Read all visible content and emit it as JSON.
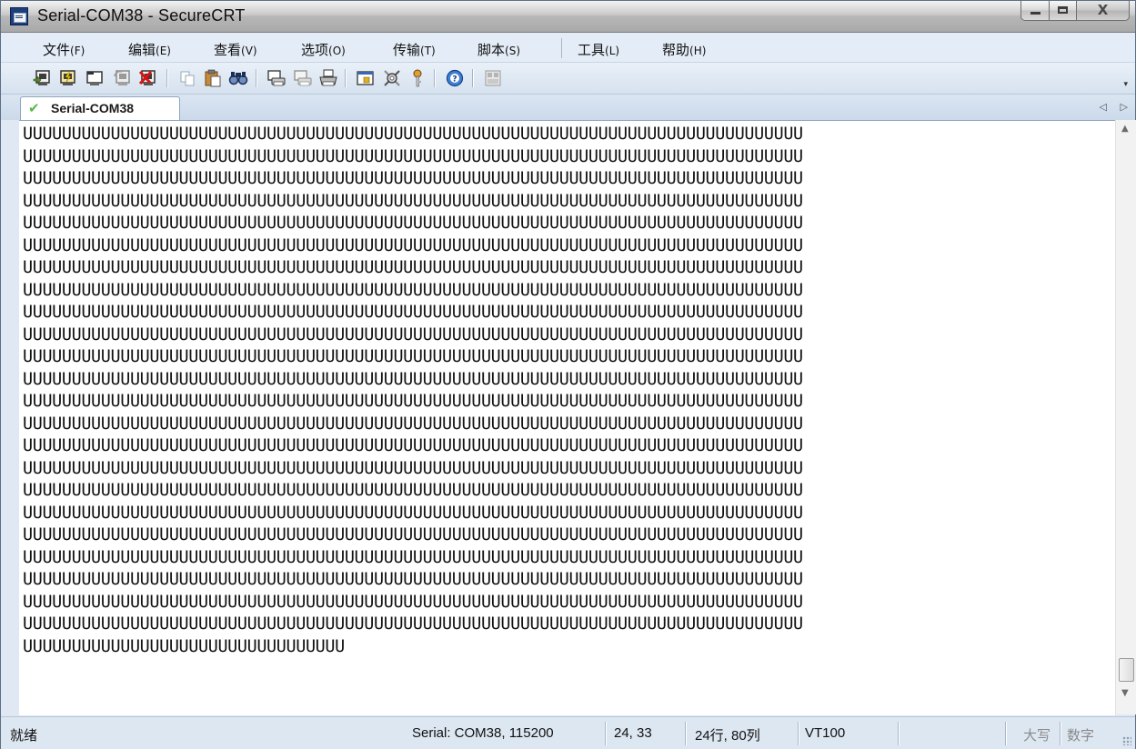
{
  "window": {
    "title": "Serial-COM38 - SecureCRT",
    "close_label": "X"
  },
  "menu": {
    "items": [
      {
        "label": "文件",
        "key": "(F)"
      },
      {
        "label": "编辑",
        "key": "(E)"
      },
      {
        "label": "查看",
        "key": "(V)"
      },
      {
        "label": "选项",
        "key": "(O)"
      },
      {
        "label": "传输",
        "key": "(T)"
      },
      {
        "label": "脚本",
        "key": "(S)"
      },
      {
        "label": "工具",
        "key": "(L)"
      },
      {
        "label": "帮助",
        "key": "(H)"
      }
    ]
  },
  "toolbar": {
    "icons": [
      "connect-icon",
      "quick-connect-icon",
      "connect-in-tab-icon",
      "reconnect-icon",
      "disconnect-icon",
      "copy-icon",
      "paste-icon",
      "find-icon",
      "print-screen-icon",
      "print-selection-icon",
      "print-icon",
      "session-options-icon",
      "global-options-icon",
      "key-map-icon",
      "help-icon",
      "about-icon"
    ]
  },
  "tabs": {
    "active": {
      "label": "Serial-COM38",
      "status_icon": "check-icon"
    },
    "scroll_left": "◁",
    "scroll_right": "▷"
  },
  "terminal": {
    "full_line": "UUUUUUUUUUUUUUUUUUUUUUUUUUUUUUUUUUUUUUUUUUUUUUUUUUUUUUUUUUUUUUUUUUUUUUUUUUUUUUUU",
    "full_line_count": 23,
    "last_line": "UUUUUUUUUUUUUUUUUUUUUUUUUUUUUUUUU"
  },
  "status": {
    "ready": "就绪",
    "connection": "Serial: COM38, 115200",
    "cursor": "24,  33",
    "size": "24行, 80列",
    "emulation": "VT100",
    "caps": "大写",
    "num": "数字"
  }
}
